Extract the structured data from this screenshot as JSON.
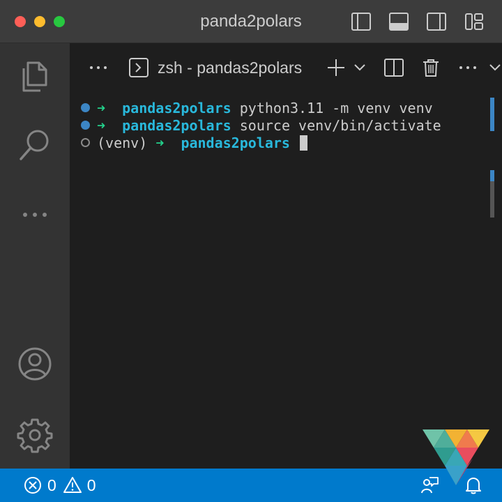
{
  "window": {
    "title": "panda2polars"
  },
  "activity_bar": {
    "items": [
      {
        "name": "explorer-icon"
      },
      {
        "name": "search-icon"
      },
      {
        "name": "more-icon"
      },
      {
        "name": "accounts-icon"
      },
      {
        "name": "settings-gear-icon"
      }
    ]
  },
  "panel": {
    "terminal_tab_label": "zsh - pandas2polars"
  },
  "terminal": {
    "lines": [
      {
        "arrow": "➜",
        "dir": "pandas2polars",
        "command": "python3.11 -m venv venv"
      },
      {
        "arrow": "➜",
        "dir": "pandas2polars",
        "command": "source venv/bin/activate"
      },
      {
        "prefix": "(venv)",
        "arrow": "➜",
        "dir": "pandas2polars",
        "command": ""
      }
    ]
  },
  "status_bar": {
    "errors": "0",
    "warnings": "0"
  },
  "colors": {
    "accent": "#007acc",
    "dir": "#29b8db",
    "arrow": "#23d18b"
  }
}
